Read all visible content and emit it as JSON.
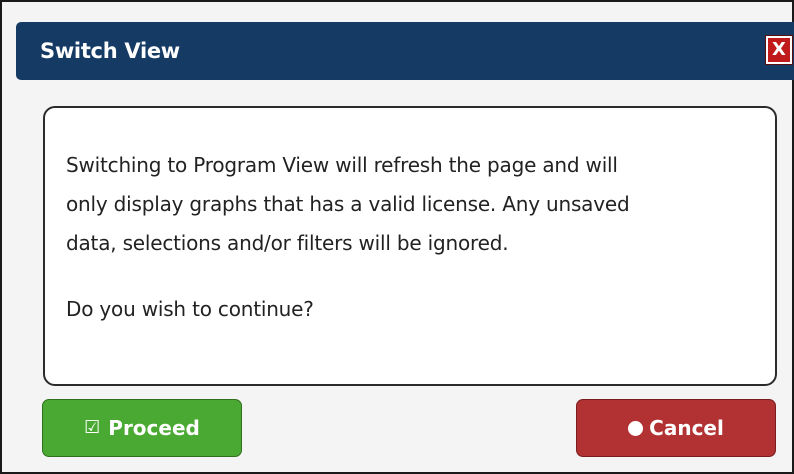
{
  "dialog": {
    "title": "Switch View",
    "close_label": "X"
  },
  "message": {
    "lines": [
      "Switching to Program View will refresh the page and will",
      "only display graphs that has a valid license. Any unsaved",
      "data, selections and/or filters will be ignored.",
      "Do you wish to continue?"
    ]
  },
  "buttons": {
    "proceed": {
      "label": "Proceed",
      "icon": "checkbox-checked-icon",
      "color": "#4aa932"
    },
    "cancel": {
      "label": "Cancel",
      "icon": "circle-icon",
      "color": "#b23233"
    }
  },
  "colors": {
    "titlebar": "#153a63",
    "close": "#c01a1a"
  }
}
